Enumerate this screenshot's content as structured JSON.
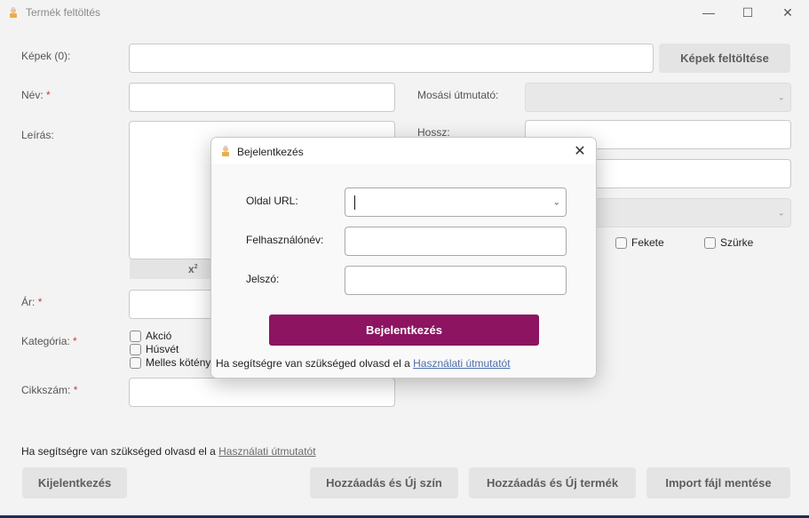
{
  "window": {
    "title": "Termék feltöltés",
    "controls": {
      "minimize": "—",
      "maximize": "☐",
      "close": "✕"
    }
  },
  "form": {
    "images_label": "Képek (0):",
    "upload_images_button": "Képek feltöltése",
    "name_label": "Név:",
    "wash_label": "Mosási útmutató:",
    "description_label": "Leírás:",
    "length_label": "Hossz:",
    "price_label": "Ár:",
    "category_label": "Kategória:",
    "sku_label": "Cikkszám:",
    "required_mark": "*",
    "superscript_label": "x",
    "superscript_exp": "2",
    "categories": [
      "Akció",
      "Húsvét",
      "Melles kötény"
    ],
    "colors": [
      "Fekete",
      "Szürke"
    ]
  },
  "footer": {
    "help_prefix": "Ha segítségre van szükséged olvasd el a",
    "help_link": "Használati útmutatót",
    "logout_button": "Kijelentkezés",
    "add_new_color_button": "Hozzáadás és Új szín",
    "add_new_product_button": "Hozzáadás és Új termék",
    "save_import_button": "Import fájl mentése"
  },
  "dialog": {
    "title": "Bejelentkezés",
    "close": "✕",
    "url_label": "Oldal URL:",
    "username_label": "Felhasználónév:",
    "password_label": "Jelszó:",
    "login_button": "Bejelentkezés",
    "help_prefix": "Ha segítségre van szükséged olvasd el a",
    "help_link": "Használati útmutatót"
  },
  "colors": {
    "accent": "#8c1461",
    "link": "#4b6ea8",
    "required": "#d13438",
    "taskbar": "#1e2b4f"
  }
}
